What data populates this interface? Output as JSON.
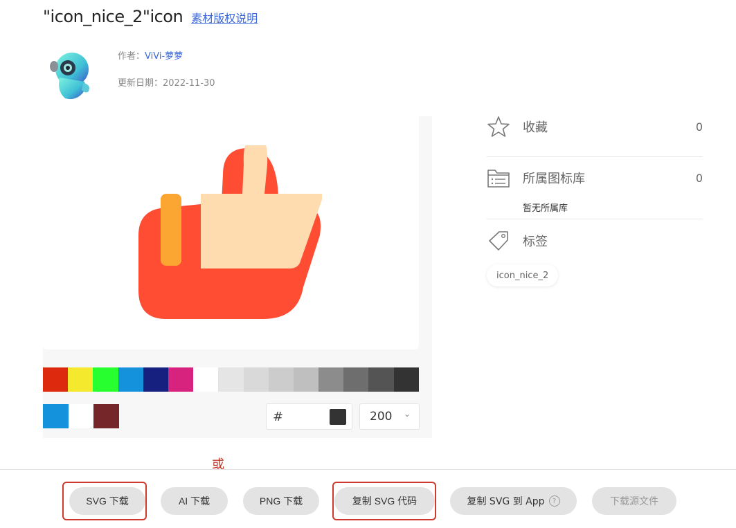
{
  "header": {
    "title": "\"icon_nice_2\"icon",
    "copyright_link": "素材版权说明"
  },
  "meta": {
    "author_label": "作者：",
    "author_name": "ViVi-萝萝",
    "date_label": "更新日期：",
    "date_value": "2022-11-30"
  },
  "icon_colors": {
    "outline": "#ff4d33",
    "fill": "#ffdcb0",
    "accent": "#fba532"
  },
  "palette": {
    "row1": [
      "#dd2a0e",
      "#f5e92e",
      "#27ff2e",
      "#1592dc",
      "#16207e",
      "#d7237e",
      "#ffffff",
      "#e5e5e5",
      "#d9d9d9",
      "#cccccc",
      "#bfbfbf",
      "#8c8c8c",
      "#6e6e6e",
      "#545454",
      "#333333"
    ],
    "row2": [
      "#1592dc",
      "#ffffff",
      "#752628"
    ]
  },
  "color_input": {
    "hash": "#",
    "value": "",
    "swatch_color": "#333333"
  },
  "size_select": {
    "value": "200"
  },
  "sidebar": {
    "favorite_label": "收藏",
    "favorite_count": "0",
    "library_label": "所属图标库",
    "library_count": "0",
    "library_empty": "暂无所属库",
    "tags_label": "标签",
    "tags": [
      "icon_nice_2"
    ]
  },
  "or_text": "或",
  "buttons": {
    "svg_download": "SVG 下载",
    "ai_download": "AI 下载",
    "png_download": "PNG 下载",
    "copy_svg_code": "复制 SVG 代码",
    "copy_svg_app": "复制 SVG 到 App",
    "download_source": "下载源文件"
  }
}
